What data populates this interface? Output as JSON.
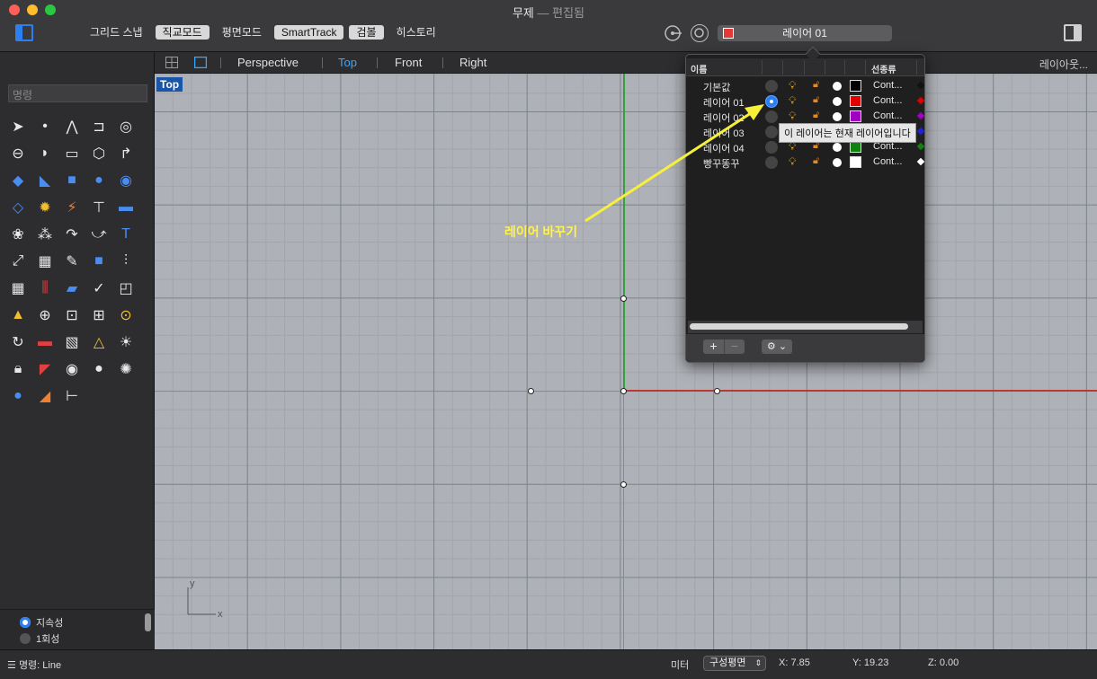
{
  "window": {
    "title": "무제",
    "subtitle": "— 편집됨"
  },
  "toolbar": {
    "modes": [
      {
        "label": "그리드 스냅",
        "on": false
      },
      {
        "label": "직교모드",
        "on": true
      },
      {
        "label": "평면모드",
        "on": false
      },
      {
        "label": "SmartTrack",
        "on": true
      },
      {
        "label": "검볼",
        "on": true
      },
      {
        "label": "히스토리",
        "on": false
      }
    ],
    "current_layer": "레이어 01",
    "current_layer_color": "#e53935"
  },
  "command": {
    "placeholder": "명령"
  },
  "viewport_tabs": {
    "items": [
      "Perspective",
      "Top",
      "Front",
      "Right"
    ],
    "active": "Top",
    "layout_label": "레이아웃..."
  },
  "viewport": {
    "label": "Top",
    "annotation": "레이어 바꾸기",
    "axis_x": "x",
    "axis_y": "y"
  },
  "osnap_options": [
    {
      "label": "지속성",
      "on": true
    },
    {
      "label": "1회성",
      "on": false
    }
  ],
  "layer_panel": {
    "col_name": "이름",
    "col_linetype": "선종류",
    "tooltip": "이 레이어는 현재 레이어입니다",
    "layers": [
      {
        "name": "기본값",
        "color": "#000000",
        "linetype": "Cont...",
        "current": false
      },
      {
        "name": "레이어 01",
        "color": "#e00000",
        "linetype": "Cont...",
        "current": true
      },
      {
        "name": "레이어 02",
        "color": "#a000c0",
        "linetype": "Cont...",
        "current": false
      },
      {
        "name": "레이어 03",
        "color": "#2020e0",
        "linetype": "Cont...",
        "current": false
      },
      {
        "name": "레이어 04",
        "color": "#108010",
        "linetype": "Cont...",
        "current": false
      },
      {
        "name": "빵꾸똥꾸",
        "color": "#ffffff",
        "linetype": "Cont...",
        "current": false
      }
    ]
  },
  "statusbar": {
    "command": "명령: Line",
    "units": "미터",
    "cplane": "구성평면",
    "x": "X: 7.85",
    "y": "Y: 19.23",
    "z": "Z: 0.00"
  }
}
